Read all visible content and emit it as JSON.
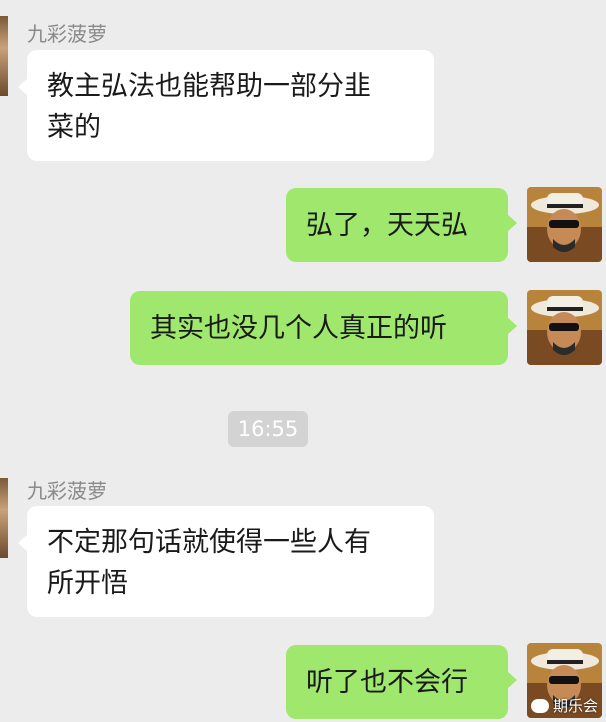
{
  "colors": {
    "background": "#ececec",
    "bubble_incoming": "#ffffff",
    "bubble_outgoing": "#9fe76d",
    "sender_name": "#8a8a8a",
    "time_chip": "#d3d3d3"
  },
  "messages": [
    {
      "direction": "incoming",
      "sender": "九彩菠萝",
      "lines": [
        "教主弘法也能帮助一部分韭",
        "菜的"
      ]
    },
    {
      "direction": "outgoing",
      "text": "弘了，天天弘"
    },
    {
      "direction": "outgoing",
      "text": "其实也没几个人真正的听"
    },
    {
      "direction": "timestamp",
      "text": "16:55"
    },
    {
      "direction": "incoming",
      "sender": "九彩菠萝",
      "lines": [
        "不定那句话就使得一些人有",
        "所开悟"
      ]
    },
    {
      "direction": "outgoing",
      "text": "听了也不会行"
    }
  ],
  "watermark": {
    "text": "期乐会",
    "icon": "wechat-icon"
  }
}
